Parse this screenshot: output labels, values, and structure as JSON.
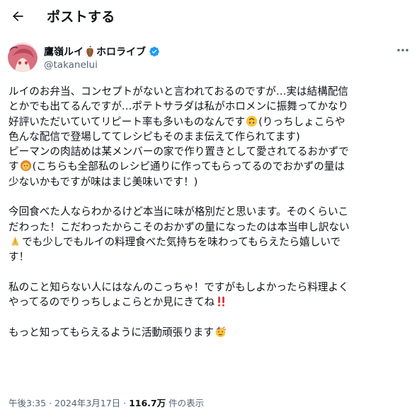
{
  "header": {
    "title": "ポストする",
    "back_icon": "arrow-left-icon"
  },
  "author": {
    "name_part1": "鷹嶺ルイ",
    "name_part2": "ホロライブ",
    "handle": "@takanelui",
    "verified_color": "#1d9bf0",
    "avatar_icon": "avatar-image"
  },
  "post": {
    "lines": [
      "ルイのお弁当、コンセプトがないと言われておるのですが…実は結構配信",
      "とかでも出てるんですが…ポテトサラダは私がホロメンに振舞ってかなり",
      "好評いただいていてリピート率も多いものなんです",
      "(りっちしょこらや",
      "色んな配信で登場しててレシピもそのまま伝えて作られてます)",
      "ピーマンの肉詰めは某メンバーの家で作り置きとして愛されてるおかず",
      "で",
      "す",
      "(こちらも全部私のレシピ通りに作ってもらってるのでおかずの量は",
      "少ないかもですが味はまじ美味いです！)",
      "今回食べた人ならわかるけど本当に味が格別だと思います。そのくらいこ",
      "だわった！こだわったからこそのおかずの量になったのは本当申し訳ない",
      "でも少しでもルイの料理食べた気持ちを味わってもらえたら嬉しいで",
      "す！",
      "私のこと知らない人にはなんのこっちゃ！ですがもしよかったら料理よく",
      "やってるのでりっちしょこらとか見にきてね",
      "もっと知ってもらえるように活動頑張ります"
    ],
    "emoji": {
      "upside_down": "upside-down-face-icon",
      "lion": "lion-icon",
      "pray": "folded-hands-icon",
      "double_exclaim": "double-exclamation-icon",
      "party": "partying-face-icon"
    }
  },
  "meta": {
    "time": "午後3:35",
    "sep1": " · ",
    "date": "2024年3月17日",
    "sep2": " · ",
    "views": "116.7万",
    "views_label": " 件の表示"
  }
}
